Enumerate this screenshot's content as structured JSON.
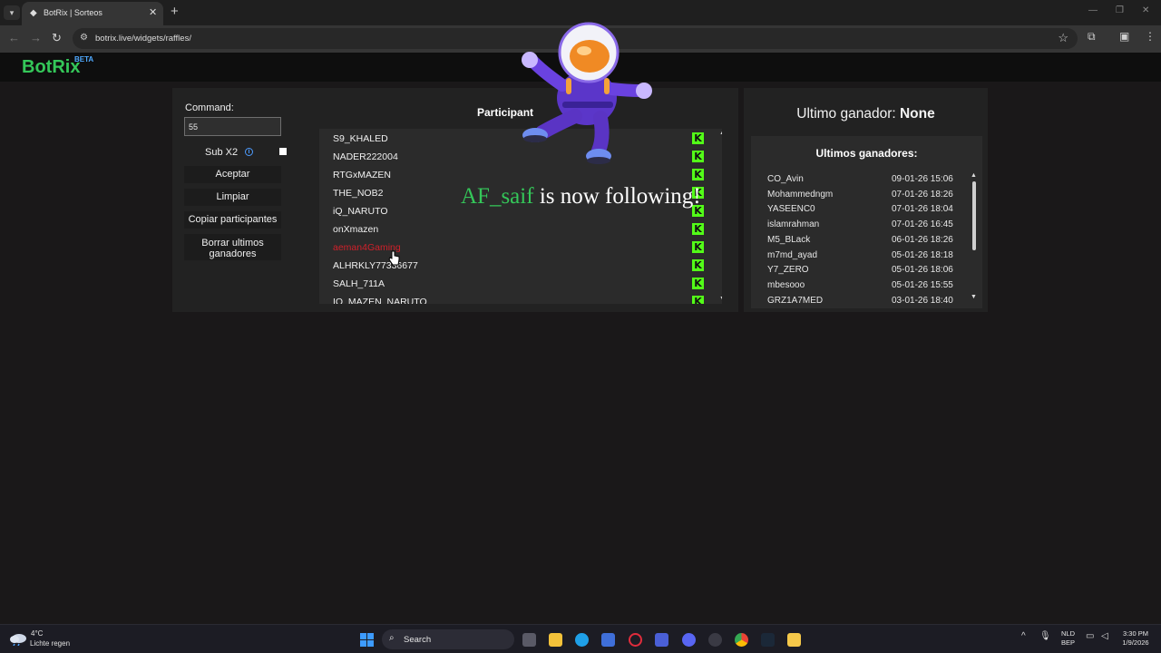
{
  "browser": {
    "tab_title": "BotRix | Sorteos",
    "url": "botrix.live/widgets/raffles/"
  },
  "site": {
    "logo": "BotRix",
    "logo_badge": "BETA"
  },
  "controls": {
    "command_label": "Command:",
    "command_value": "55",
    "sub_label": "Sub X2",
    "sub_checked": false,
    "accept_label": "Aceptar",
    "clear_label": "Limpiar",
    "copy_label": "Copiar participantes",
    "clear_winners_label": "Borrar ultimos ganadores"
  },
  "participants": {
    "title": "Participant",
    "items": [
      "S9_KHALED",
      "NADER222004",
      "RTGxMAZEN",
      "THE_NOB2",
      "iQ_NARUTO",
      "onXmazen",
      "aeman4Gaming",
      "ALHRKLY77336677",
      "SALH_711A",
      "IQ_MAZEN_NARUTO"
    ],
    "highlighted_index": 6,
    "platform_icon": "kick-icon"
  },
  "last_winner": {
    "label": "Ultimo ganador:",
    "value": "None"
  },
  "winners": {
    "title": "Ultimos ganadores:",
    "items": [
      {
        "name": "CO_Avin",
        "date": "09-01-26 15:06"
      },
      {
        "name": "Mohammedngm",
        "date": "07-01-26 18:26"
      },
      {
        "name": "YASEENC0",
        "date": "07-01-26 18:04"
      },
      {
        "name": "islamrahman",
        "date": "07-01-26 16:45"
      },
      {
        "name": "M5_BLack",
        "date": "06-01-26 18:26"
      },
      {
        "name": "m7md_ayad",
        "date": "05-01-26 18:18"
      },
      {
        "name": "Y7_ZERO",
        "date": "05-01-26 18:06"
      },
      {
        "name": "mbesooo",
        "date": "05-01-26 15:55"
      },
      {
        "name": "GRZ1A7MED",
        "date": "03-01-26 18:40"
      }
    ]
  },
  "alert": {
    "follower": "AF_saif",
    "text": "is now following!"
  },
  "taskbar": {
    "temperature": "4°C",
    "weather": "Lichte regen",
    "search_placeholder": "Search",
    "lang_top": "NLD",
    "lang_bottom": "BEP",
    "time": "3:30 PM",
    "date": "1/9/2026"
  },
  "colors": {
    "accent_green": "#34c759",
    "kick_green": "#53fc18",
    "highlight_red": "#d0202a",
    "panel_bg": "#222222"
  }
}
